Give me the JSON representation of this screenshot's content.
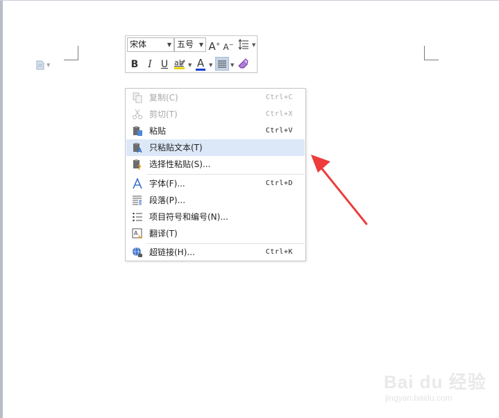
{
  "toolbar": {
    "font_name": "宋体",
    "font_size": "五号",
    "grow_font": "A",
    "shrink_font": "A",
    "bold": "B",
    "italic": "I",
    "underline": "U",
    "font_color_letter": "A",
    "font_color": "#1a3ccf",
    "highlight_color": "#e8d200"
  },
  "menu": {
    "items": [
      {
        "label": "复制(C)",
        "shortcut": "Ctrl+C",
        "icon": "copy-icon",
        "disabled": true
      },
      {
        "label": "剪切(T)",
        "shortcut": "Ctrl+X",
        "icon": "scissors-icon",
        "disabled": true
      },
      {
        "label": "粘贴",
        "shortcut": "Ctrl+V",
        "icon": "paste-icon",
        "disabled": false
      },
      {
        "label": "只粘贴文本(T)",
        "shortcut": "",
        "icon": "paste-text-icon",
        "disabled": false,
        "highlighted": true
      },
      {
        "label": "选择性粘贴(S)...",
        "shortcut": "",
        "icon": "paste-special-icon",
        "disabled": false
      },
      {
        "label": "字体(F)...",
        "shortcut": "Ctrl+D",
        "icon": "font-icon",
        "disabled": false
      },
      {
        "label": "段落(P)...",
        "shortcut": "",
        "icon": "paragraph-icon",
        "disabled": false
      },
      {
        "label": "项目符号和编号(N)...",
        "shortcut": "",
        "icon": "bullets-icon",
        "disabled": false
      },
      {
        "label": "翻译(T)",
        "shortcut": "",
        "icon": "translate-icon",
        "disabled": false
      },
      {
        "label": "超链接(H)...",
        "shortcut": "Ctrl+K",
        "icon": "hyperlink-icon",
        "disabled": false
      }
    ]
  },
  "watermark": {
    "brand": "Bai du 经验",
    "url": "jingyan.baidu.com"
  },
  "colors": {
    "accent_arrow": "#ee3b3b",
    "menu_highlight": "#dce8f7"
  }
}
